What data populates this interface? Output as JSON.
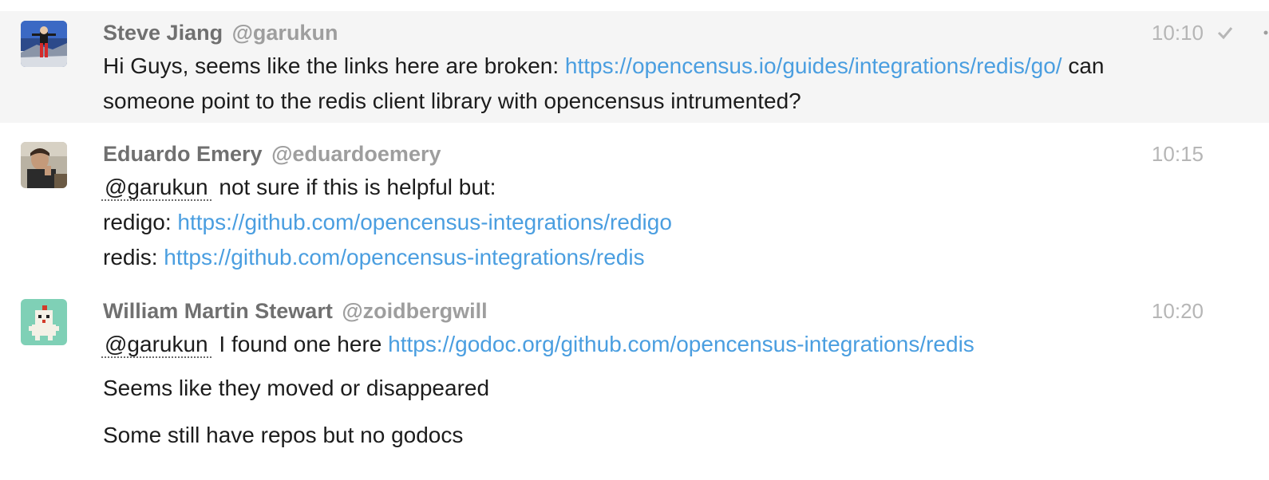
{
  "messages": [
    {
      "author": "Steve Jiang",
      "handle": "@garukun",
      "time": "10:10",
      "lines": {
        "l1_text": "Hi Guys, seems like the links here are broken:",
        "l1_link": "https://opencensus.io/guides/integrations/redis/go/",
        "l1_after": "can",
        "l2_text": "someone point to the redis client library with opencensus intrumented?"
      }
    },
    {
      "author": "Eduardo Emery",
      "handle": "@eduardoemery",
      "time": "10:15",
      "lines": {
        "mention": "@garukun",
        "l1_text": "not sure if this is helpful but:",
        "l2_text": "redigo:",
        "l2_link": "https://github.com/opencensus-integrations/redigo",
        "l3_text": "redis:",
        "l3_link": "https://github.com/opencensus-integrations/redis"
      }
    },
    {
      "author": "William Martin Stewart",
      "handle": "@zoidbergwill",
      "time": "10:20",
      "lines": {
        "mention": "@garukun",
        "l1_text": "I found one here",
        "l1_link": "https://godoc.org/github.com/opencensus-integrations/redis",
        "l2_text": "Seems like they moved or disappeared",
        "l3_text": "Some still have repos but no godocs"
      }
    }
  ],
  "icons": {
    "read_receipt": "checkmark-icon",
    "more": "more-options-icon"
  },
  "colors": {
    "link": "#4a9ee0",
    "author": "#707070",
    "handle": "#9e9e9e",
    "time": "#b6b6b6",
    "highlight_bg": "#f5f5f5"
  }
}
